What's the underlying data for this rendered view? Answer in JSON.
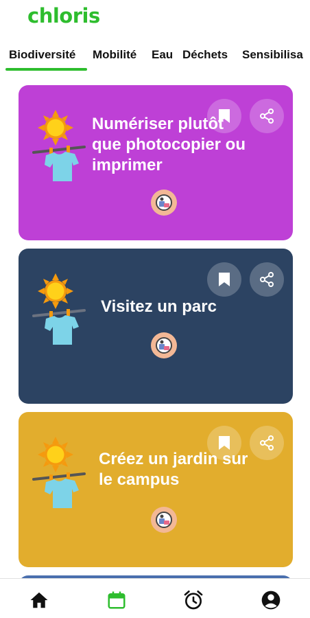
{
  "app": {
    "logo_text": "chloris"
  },
  "tabs": [
    {
      "label": "Biodiversité",
      "active": true
    },
    {
      "label": "Mobilité",
      "active": false
    },
    {
      "label": "Eau",
      "active": false
    },
    {
      "label": "Déchets",
      "active": false
    },
    {
      "label": "Sensibilisa",
      "active": false
    }
  ],
  "cards": [
    {
      "title": "Numériser plutôt que photocopier ou imprimer",
      "bg_color": "#be40d6",
      "bookmark_icon": "bookmark-icon",
      "share_icon": "share-icon",
      "avatar_icon": "avatar-icon"
    },
    {
      "title": "Visitez un parc",
      "bg_color": "#2c4362",
      "bookmark_icon": "bookmark-icon",
      "share_icon": "share-icon",
      "avatar_icon": "avatar-icon"
    },
    {
      "title": "Créez un jardin sur le campus",
      "bg_color": "#e2ad2d",
      "bookmark_icon": "bookmark-icon",
      "share_icon": "share-icon",
      "avatar_icon": "avatar-icon"
    },
    {
      "title": "",
      "bg_color": "#4a6fae"
    }
  ],
  "bottom_nav": [
    {
      "icon": "home-icon",
      "active": false
    },
    {
      "icon": "calendar-icon",
      "active": true
    },
    {
      "icon": "alarm-clock-icon",
      "active": false
    },
    {
      "icon": "account-icon",
      "active": false
    }
  ],
  "colors": {
    "accent": "#2ebd2e",
    "text_dark": "#111111"
  }
}
